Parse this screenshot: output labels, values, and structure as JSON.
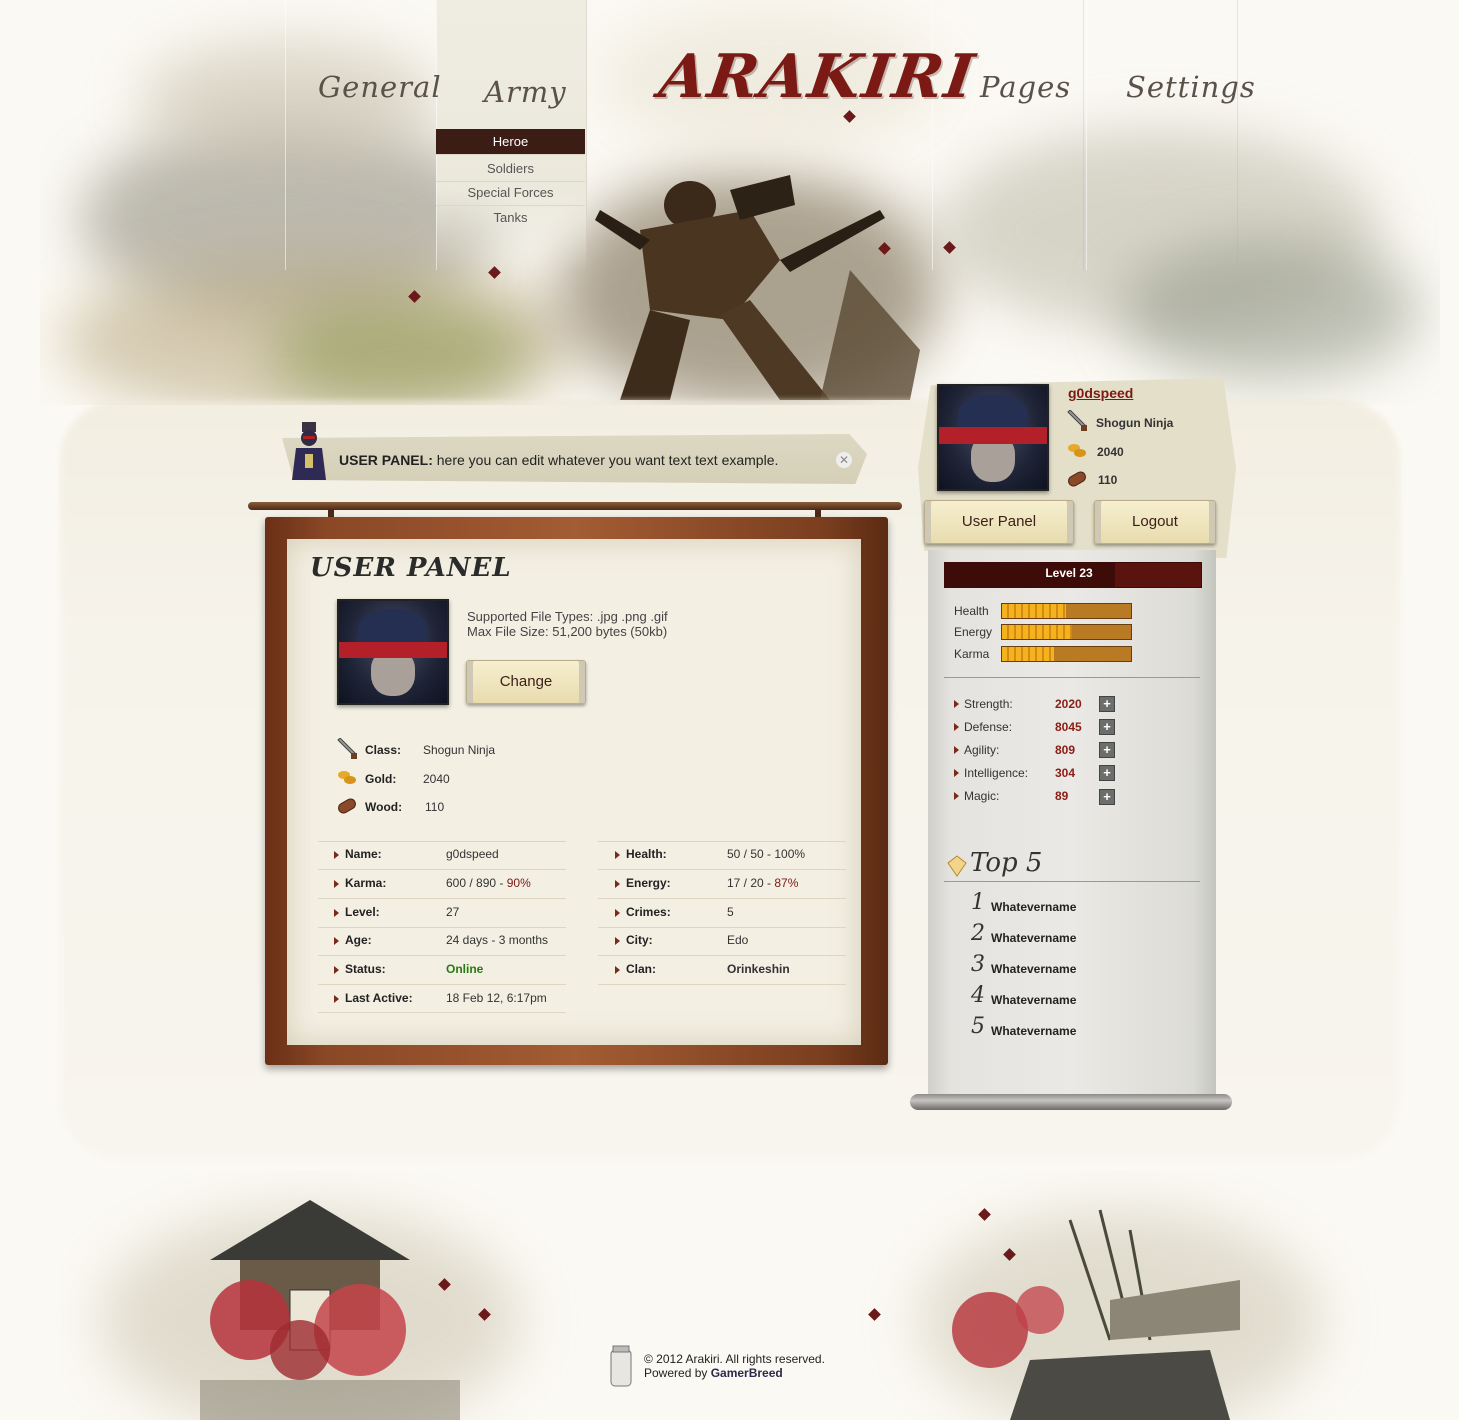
{
  "brand": {
    "logo": "ARAKIRI"
  },
  "nav": {
    "items": [
      {
        "label": "General"
      },
      {
        "label": "Army"
      },
      {
        "label": "Pages"
      },
      {
        "label": "Settings"
      }
    ],
    "army_submenu": [
      "Heroe",
      "Soldiers",
      "Special Forces",
      "Tanks"
    ]
  },
  "notice": {
    "title": "USER PANEL:",
    "text": "here you can edit whatever you want text text example."
  },
  "panel": {
    "title": "USER PANEL",
    "supported": "Supported File Types: .jpg   .png   .gif",
    "max_size": "Max File Size: 51,200 bytes (50kb)",
    "change_label": "Change",
    "resources": [
      {
        "label": "Class:",
        "value": "Shogun Ninja",
        "icon": "sword-icon"
      },
      {
        "label": "Gold:",
        "value": "2040",
        "icon": "gold-icon"
      },
      {
        "label": "Wood:",
        "value": "110",
        "icon": "wood-icon"
      }
    ],
    "details_left": [
      {
        "label": "Name:",
        "value": "g0dspeed"
      },
      {
        "label": "Karma:",
        "value": "600 / 890 - ",
        "extra": "90%"
      },
      {
        "label": "Level:",
        "value": "27"
      },
      {
        "label": "Age:",
        "value": "24 days - 3 months"
      },
      {
        "label": "Status:",
        "value": "Online"
      },
      {
        "label": "Last Active:",
        "value": "18 Feb 12, 6:17pm"
      }
    ],
    "details_right": [
      {
        "label": "Health:",
        "value": "50 / 50 - 100%"
      },
      {
        "label": "Energy:",
        "value": "17 / 20 - ",
        "extra": "87%"
      },
      {
        "label": "Crimes:",
        "value": "5"
      },
      {
        "label": "City:",
        "value": "Edo"
      },
      {
        "label": "Clan:",
        "value": "Orinkeshin"
      }
    ]
  },
  "sidebar": {
    "username": "g0dspeed",
    "class": "Shogun Ninja",
    "gold": "2040",
    "wood": "110",
    "user_panel_label": "User Panel",
    "logout_label": "Logout",
    "level_label": "Level 23",
    "level_progress": 0.67,
    "bars": [
      {
        "label": "Health",
        "progress": 0.5
      },
      {
        "label": "Energy",
        "progress": 0.55
      },
      {
        "label": "Karma",
        "progress": 0.41
      }
    ],
    "stats": [
      {
        "label": "Strength:",
        "value": "2020"
      },
      {
        "label": "Defense:",
        "value": "8045"
      },
      {
        "label": "Agility:",
        "value": "809"
      },
      {
        "label": "Intelligence:",
        "value": "304"
      },
      {
        "label": "Magic:",
        "value": "89"
      }
    ],
    "top5_title": "Top 5",
    "top5": [
      {
        "rank": "1",
        "name": "Whatevername"
      },
      {
        "rank": "2",
        "name": "Whatevername"
      },
      {
        "rank": "3",
        "name": "Whatevername"
      },
      {
        "rank": "4",
        "name": "Whatevername"
      },
      {
        "rank": "5",
        "name": "Whatevername"
      }
    ]
  },
  "footer": {
    "copyright": "© 2012 Arakiri. All rights reserved.",
    "powered_prefix": "Powered by ",
    "powered_brand": "GamerBreed"
  }
}
